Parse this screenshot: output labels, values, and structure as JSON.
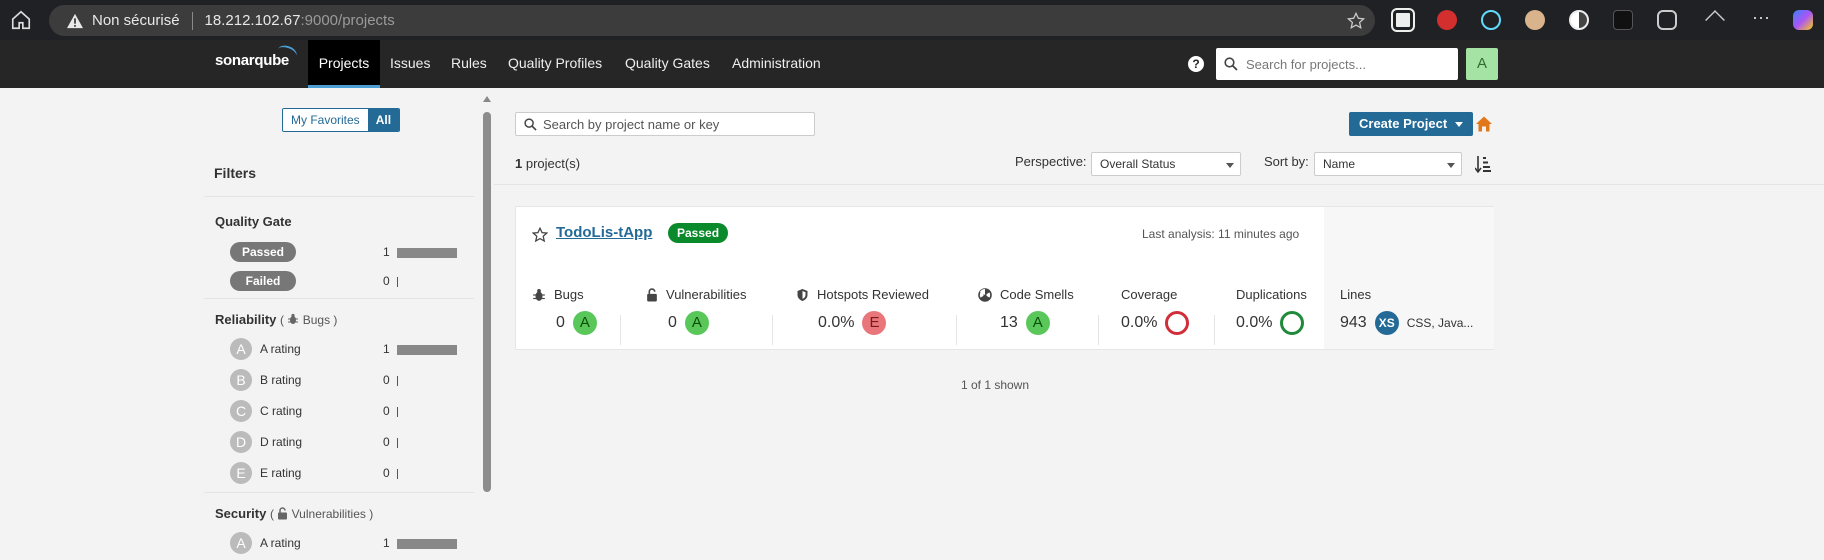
{
  "browser": {
    "security_label": "Non sécurisé",
    "url_host": "18.212.102.67",
    "url_path": ":9000/projects"
  },
  "nav": {
    "logo": "sonarqube",
    "items": [
      "Projects",
      "Issues",
      "Rules",
      "Quality Profiles",
      "Quality Gates",
      "Administration"
    ],
    "active": "Projects",
    "search_placeholder": "Search for projects...",
    "avatar": "A"
  },
  "sidebar": {
    "favorites_label": "My Favorites",
    "all_label": "All",
    "filters_title": "Filters",
    "quality_gate": {
      "title": "Quality Gate",
      "rows": [
        {
          "label": "Passed",
          "count": "1"
        },
        {
          "label": "Failed",
          "count": "0"
        }
      ]
    },
    "reliability": {
      "title": "Reliability",
      "sub": "Bugs",
      "rows": [
        {
          "grade": "A",
          "label": "A rating",
          "count": "1"
        },
        {
          "grade": "B",
          "label": "B rating",
          "count": "0"
        },
        {
          "grade": "C",
          "label": "C rating",
          "count": "0"
        },
        {
          "grade": "D",
          "label": "D rating",
          "count": "0"
        },
        {
          "grade": "E",
          "label": "E rating",
          "count": "0"
        }
      ]
    },
    "security": {
      "title": "Security",
      "sub": "Vulnerabilities",
      "rows": [
        {
          "grade": "A",
          "label": "A rating",
          "count": "1"
        }
      ]
    }
  },
  "main": {
    "search_placeholder": "Search by project name or key",
    "create_label": "Create Project",
    "project_count": "1",
    "project_count_suffix": " project(s)",
    "perspective_label": "Perspective:",
    "perspective_value": "Overall Status",
    "sort_label": "Sort by:",
    "sort_value": "Name",
    "shown_text": "1 of 1 shown",
    "project": {
      "name": "TodoLis-tApp",
      "gate": "Passed",
      "last_analysis": "Last analysis: 11 minutes ago",
      "metrics": {
        "bugs": {
          "label": "Bugs",
          "value": "0",
          "grade": "A"
        },
        "vulnerabilities": {
          "label": "Vulnerabilities",
          "value": "0",
          "grade": "A"
        },
        "hotspots": {
          "label": "Hotspots Reviewed",
          "value": "0.0%",
          "grade": "E"
        },
        "code_smells": {
          "label": "Code Smells",
          "value": "13",
          "grade": "A"
        },
        "coverage": {
          "label": "Coverage",
          "value": "0.0%"
        },
        "duplications": {
          "label": "Duplications",
          "value": "0.0%"
        },
        "lines": {
          "label": "Lines",
          "value": "943",
          "size": "XS",
          "languages": "CSS, Java..."
        }
      }
    }
  },
  "colors": {
    "accent": "#236a97",
    "passed": "#0a8a2a",
    "grade_a": "#59c759",
    "grade_e": "#e9767a",
    "coverage_ring": "#d02f3a",
    "duplication_ring": "#1f8a3a"
  }
}
